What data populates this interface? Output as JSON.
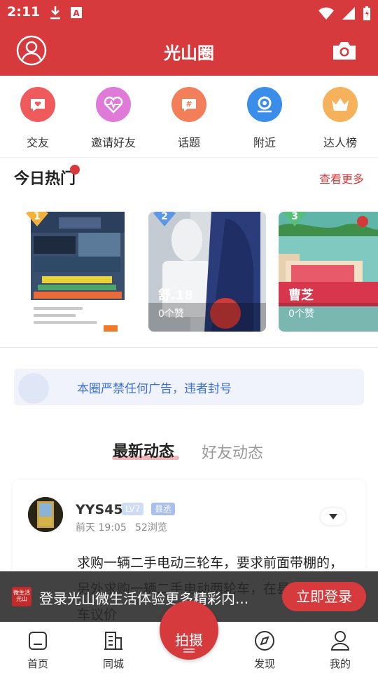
{
  "status_bar": {
    "time": "2:11"
  },
  "header": {
    "title": "光山圈"
  },
  "quick_nav": [
    {
      "label": "交友",
      "icon": "heart-chat-icon",
      "color": "#ef5a5d"
    },
    {
      "label": "邀请好友",
      "icon": "heartbeat-icon",
      "color": "#e07ad8"
    },
    {
      "label": "话题",
      "icon": "hashtag-icon",
      "color": "#f27f5a"
    },
    {
      "label": "附近",
      "icon": "location-icon",
      "color": "#3a8de8"
    },
    {
      "label": "达人榜",
      "icon": "crown-icon",
      "color": "#f6b25a"
    }
  ],
  "hot": {
    "title": "今日热门",
    "more": "查看更多",
    "cards": [
      {
        "rank": "1",
        "rank_color": "#f4b23b",
        "name": "",
        "likes": ""
      },
      {
        "rank": "2",
        "rank_color": "#5c97e8",
        "name": "舒.18",
        "likes": "0个赞"
      },
      {
        "rank": "3",
        "rank_color": "#56c07a",
        "name": "曹芝",
        "likes": "0个赞"
      }
    ]
  },
  "notice": {
    "text": "本圈严禁任何广告，违者封号"
  },
  "tabs": {
    "latest": "最新动态",
    "friends": "好友动态"
  },
  "post": {
    "username": "YYS45",
    "level": "LV7",
    "role": "县丞",
    "time": "前天 19:05",
    "views": "52浏览",
    "text": "求购一辆二手电动三轮车，要求前面带棚的，另外求购一辆二手电动两轮车，在县城内，看车议价"
  },
  "login_banner": {
    "logo_text": "微生活 光山",
    "text": "登录光山微生活体验更多精彩内...",
    "button": "立即登录"
  },
  "bottom_nav": {
    "home": "首页",
    "city": "同城",
    "shoot": "拍摄",
    "discover": "发现",
    "mine": "我的"
  }
}
